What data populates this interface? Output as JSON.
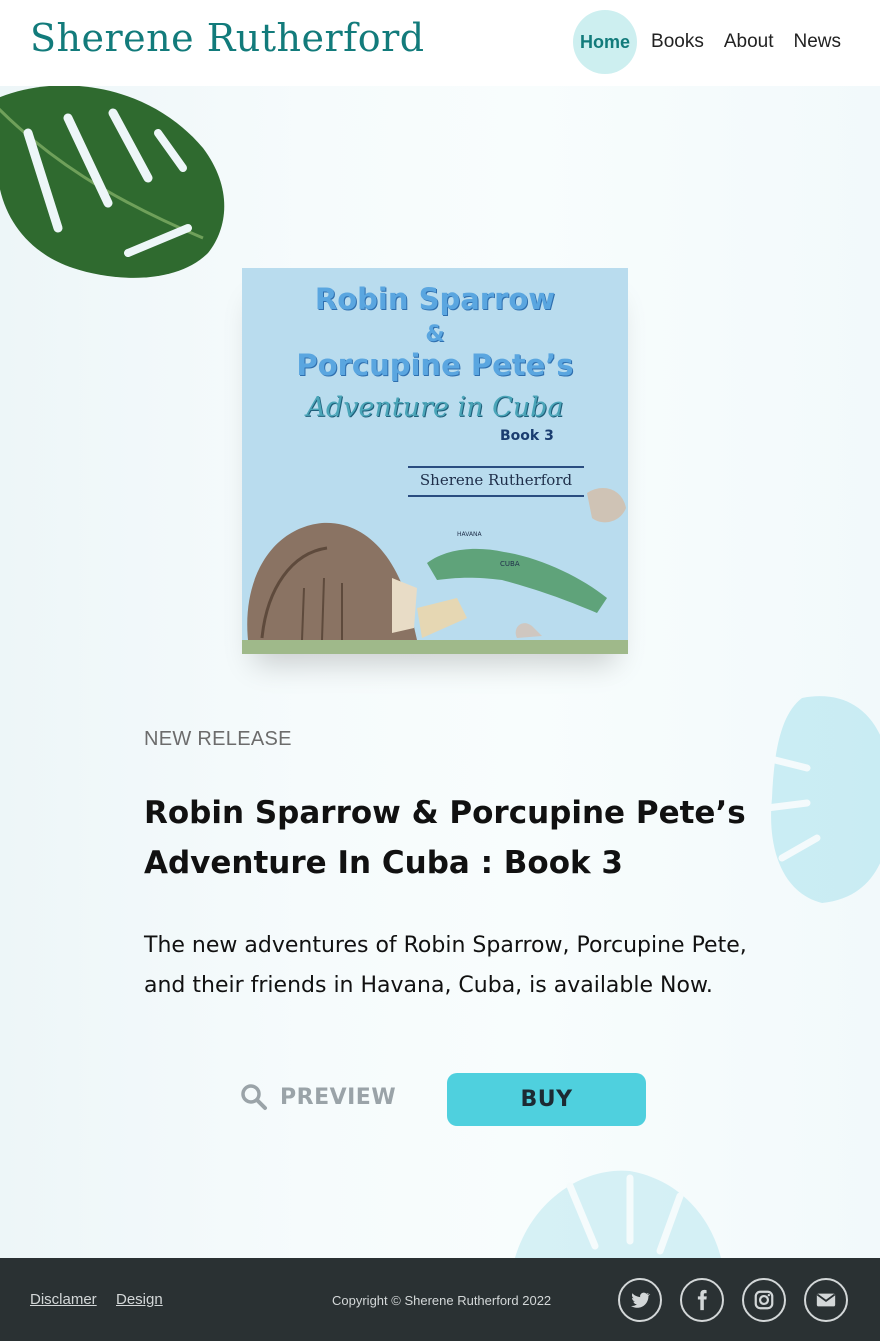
{
  "header": {
    "site_title": "Sherene Rutherford",
    "nav": [
      {
        "label": "Home",
        "active": true
      },
      {
        "label": "Books"
      },
      {
        "label": "About"
      },
      {
        "label": "News"
      }
    ]
  },
  "cover": {
    "title_line1": "Robin Sparrow",
    "title_amp": "&",
    "title_line2": "Porcupine Pete’s",
    "subtitle": "Adventure in Cuba",
    "book_label": "Book 3",
    "author": "Sherene Rutherford"
  },
  "hero": {
    "eyebrow": "NEW RELEASE",
    "headline": "Robin Sparrow & Porcupine Pete’s Adventure In Cuba : Book 3",
    "description": "The new adventures of Robin Sparrow, Porcupine Pete, and their friends in Havana, Cuba, is available Now.",
    "preview_label": "PREVIEW",
    "buy_label": "BUY"
  },
  "footer": {
    "links": [
      "Disclamer",
      "Design"
    ],
    "copyright": "Copyright © Sherene Rutherford 2022",
    "social_icons": [
      "twitter-icon",
      "facebook-icon",
      "instagram-icon",
      "email-icon"
    ]
  },
  "colors": {
    "brand_teal": "#127b7b",
    "nav_active_bg": "#cdeff0",
    "buy_button": "#4fd0de",
    "footer_bg": "#2a3133"
  }
}
